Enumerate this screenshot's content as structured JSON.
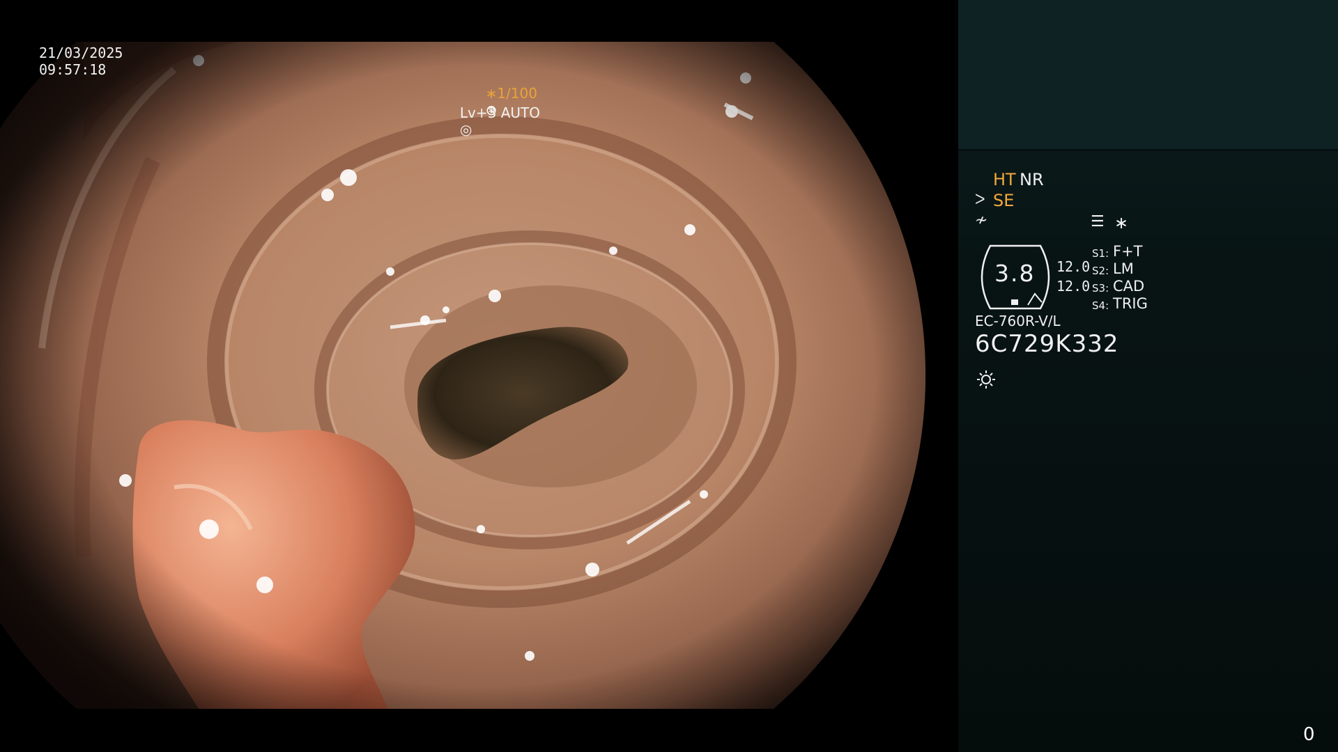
{
  "overlay": {
    "date": "21/03/2025",
    "time": "09:57:18",
    "shutter": "∗1/100",
    "level": "Lv+3 AUTO"
  },
  "panel": {
    "modes": {
      "ht": "HT",
      "nr": "NR",
      "se": "SE"
    },
    "icons": [
      "enhancement-icon",
      "structure-icon",
      "menu-icon",
      "star-icon",
      "light-icon",
      "aperture-icon"
    ],
    "gauge": {
      "value": "3.8",
      "line1": "12.0",
      "line2": "12.0"
    },
    "switches": [
      {
        "label": "S1:",
        "value": "F+T"
      },
      {
        "label": "S2:",
        "value": "LM"
      },
      {
        "label": "S3:",
        "value": "CAD"
      },
      {
        "label": "S4:",
        "value": "TRIG"
      }
    ],
    "model": "EC-760R-V/L",
    "serial": "6C729K332",
    "star": "∗"
  },
  "counter": "0",
  "colors": {
    "accent_orange": "#f2a93b",
    "panel_bg": "#081414",
    "panel_top": "#0e2224"
  }
}
